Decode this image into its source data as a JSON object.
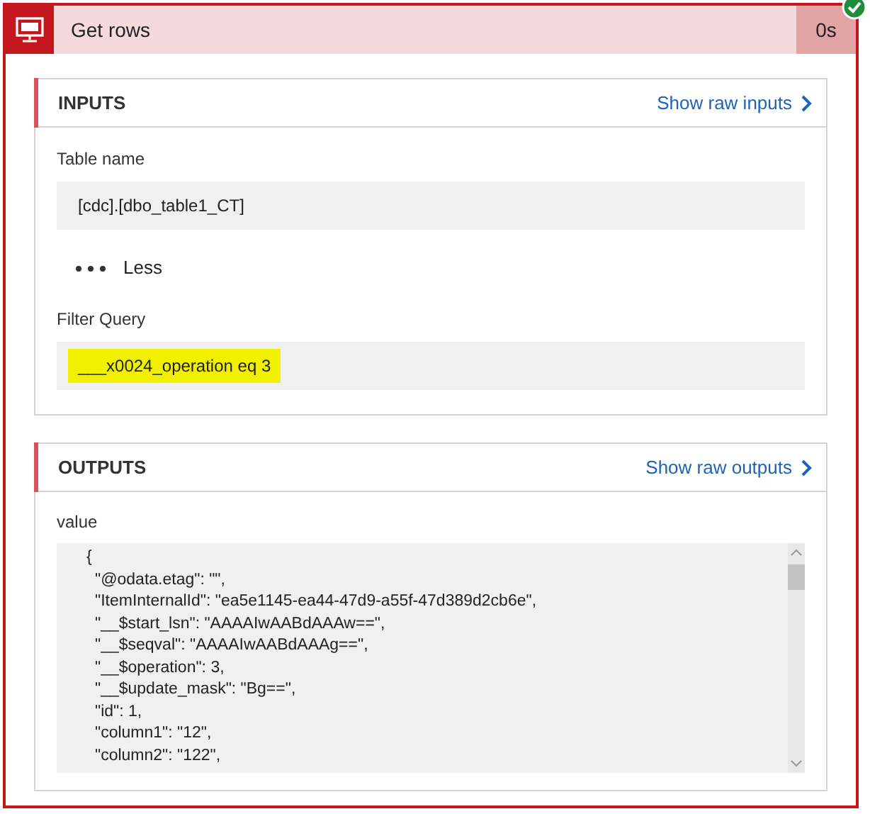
{
  "action": {
    "title": "Get rows",
    "duration": "0s",
    "succeeded": true
  },
  "inputs": {
    "heading": "INPUTS",
    "link": "Show raw inputs",
    "fields": [
      {
        "label": "Table name",
        "value": "[cdc].[dbo_table1_CT]",
        "highlighted": false
      },
      {
        "label": "Filter Query",
        "value": "___x0024_operation eq 3",
        "highlighted": true
      }
    ],
    "toggle": "Less"
  },
  "outputs": {
    "heading": "OUTPUTS",
    "link": "Show raw outputs",
    "label": "value",
    "code": {
      "open": "{",
      "entries": [
        "\"@odata.etag\": \"\",",
        "\"ItemInternalId\": \"ea5e1145-ea44-47d9-a55f-47d389d2cb6e\",",
        "\"__$start_lsn\": \"AAAAIwAABdAAAw==\",",
        "\"__$seqval\": \"AAAAIwAABdAAAg==\",",
        "\"__$operation\": 3,",
        "\"__$update_mask\": \"Bg==\",",
        "\"id\": 1,",
        "\"column1\": \"12\",",
        "\"column2\": \"122\","
      ]
    }
  }
}
